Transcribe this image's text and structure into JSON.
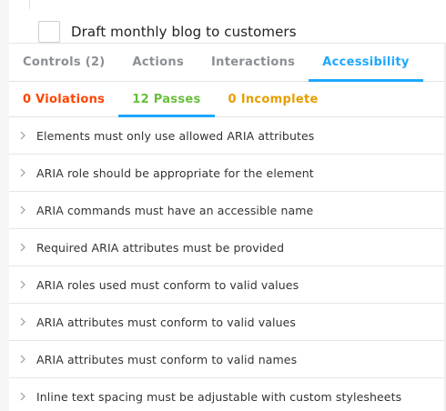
{
  "preview": {
    "todo_text": "Draft monthly blog to customers"
  },
  "tabs": [
    {
      "label": "Controls (2)",
      "active": false
    },
    {
      "label": "Actions",
      "active": false
    },
    {
      "label": "Interactions",
      "active": false
    },
    {
      "label": "Accessibility",
      "active": true
    }
  ],
  "subtabs": [
    {
      "label": "0 Violations",
      "color": "#ff4400"
    },
    {
      "label": "12 Passes",
      "color": "#66bf3c",
      "active": true
    },
    {
      "label": "0 Incomplete",
      "color": "#e69d00"
    }
  ],
  "rules": [
    {
      "label": "Elements must only use allowed ARIA attributes"
    },
    {
      "label": "ARIA role should be appropriate for the element"
    },
    {
      "label": "ARIA commands must have an accessible name"
    },
    {
      "label": "Required ARIA attributes must be provided"
    },
    {
      "label": "ARIA roles used must conform to valid values"
    },
    {
      "label": "ARIA attributes must conform to valid values"
    },
    {
      "label": "ARIA attributes must conform to valid names"
    },
    {
      "label": "Inline text spacing must be adjustable with custom stylesheets"
    }
  ],
  "icons": {
    "rule_expander": "chevron-right-icon"
  },
  "colors": {
    "accent": "#1ea7fd"
  }
}
